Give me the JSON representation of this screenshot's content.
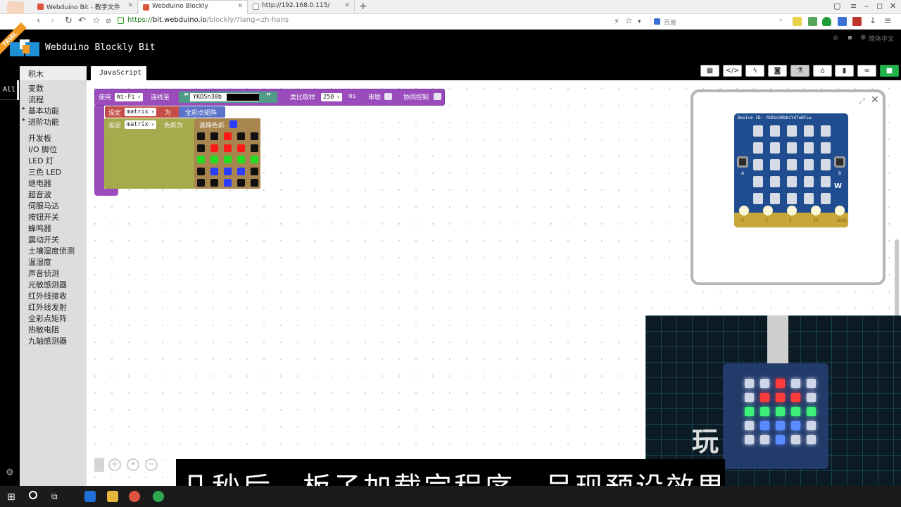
{
  "browser": {
    "tabs": [
      {
        "title": "Webduino Bit - 教学文件",
        "active": false
      },
      {
        "title": "Webduino Blockly",
        "active": true
      },
      {
        "title": "http://192.168.0.115/",
        "active": false
      }
    ],
    "url_scheme": "https://",
    "url_host": "bit.webduino.io",
    "url_path": "/blockly/?lang=zh-hans",
    "search_placeholder": "百度"
  },
  "header": {
    "trial_ribbon": "TRIAL",
    "app_title": "Webduino Blockly Bit",
    "language": "简体中文"
  },
  "toolbar": {
    "editor_tab": "JavaScript",
    "buttons": [
      "qr-code",
      "code",
      "flash",
      "save",
      "lab",
      "library",
      "trash",
      "link",
      "run"
    ]
  },
  "sidebar": {
    "all_tab": "All",
    "header": "积木",
    "categories": [
      {
        "label": "变数",
        "expand": false
      },
      {
        "label": "流程",
        "expand": false
      },
      {
        "label": "基本功能",
        "expand": true
      },
      {
        "label": "进阶功能",
        "expand": true
      },
      {
        "label": "开发板",
        "expand": false
      },
      {
        "label": "I/O 脚位",
        "expand": false
      },
      {
        "label": "LED 灯",
        "expand": false
      },
      {
        "label": "三色 LED",
        "expand": false
      },
      {
        "label": "继电器",
        "expand": false
      },
      {
        "label": "超音波",
        "expand": false
      },
      {
        "label": "伺服马达",
        "expand": false
      },
      {
        "label": "按钮开关",
        "expand": false
      },
      {
        "label": "蜂鸣器",
        "expand": false
      },
      {
        "label": "震动开关",
        "expand": false
      },
      {
        "label": "土壤湿度侦测",
        "expand": false
      },
      {
        "label": "温湿度",
        "expand": false
      },
      {
        "label": "声音侦测",
        "expand": false
      },
      {
        "label": "光敏感测器",
        "expand": false
      },
      {
        "label": "红外线接收",
        "expand": false
      },
      {
        "label": "红外线发射",
        "expand": false
      },
      {
        "label": "全彩点矩阵",
        "expand": false
      },
      {
        "label": "热敏电阻",
        "expand": false
      },
      {
        "label": "九轴感测器",
        "expand": false
      }
    ]
  },
  "blocks": {
    "board": {
      "use_label": "使用",
      "conn_type": "Wi-Fi",
      "connect_label": "连线至",
      "open_quote": "“",
      "close_quote": "”",
      "device_id": "YKDSn30b",
      "sampling_label": "类比取样",
      "sampling_value": "250",
      "sampling_unit": "ms",
      "serial_label": "串联",
      "sync_label": "协同控制"
    },
    "set_matrix": {
      "set_label": "设定",
      "var_name": "matrix",
      "as_label": "为",
      "value_block": "全彩点矩阵"
    },
    "set_color": {
      "set_label": "设定",
      "var_name": "matrix",
      "color_label": "色彩为",
      "picker_label": "选择色彩",
      "picker_color": "#2b3cff",
      "grid": [
        [
          "black",
          "black",
          "red",
          "black",
          "black"
        ],
        [
          "black",
          "red",
          "red",
          "red",
          "black"
        ],
        [
          "green",
          "green",
          "green",
          "green",
          "green"
        ],
        [
          "black",
          "blue",
          "blue",
          "blue",
          "black"
        ],
        [
          "black",
          "black",
          "blue",
          "black",
          "black"
        ]
      ]
    }
  },
  "palette": {
    "black": "#111111",
    "red": "#ff1a1a",
    "green": "#22dd22",
    "blue": "#2b3cff"
  },
  "simulator": {
    "board_label": "Device ID: YKDSn30b8iYdTwDFLw",
    "button_a": "A",
    "button_b": "B",
    "logo": "W",
    "pins": [
      "0",
      "1",
      "2",
      "3V",
      "GND"
    ]
  },
  "video": {
    "watermark": "玩"
  },
  "subtitle": "几秒后，板子加载完程序，呈现预设效果"
}
